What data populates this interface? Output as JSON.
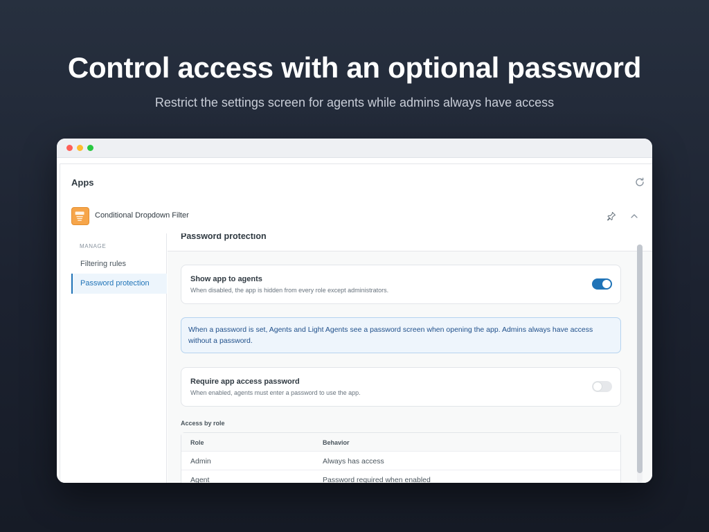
{
  "hero": {
    "title": "Control access with an optional password",
    "subtitle": "Restrict the settings screen for agents while admins always have access"
  },
  "window": {
    "controls": [
      "close",
      "minimize",
      "maximize"
    ]
  },
  "apps": {
    "header": "Apps",
    "refresh_icon": "refresh-icon",
    "app_name": "Conditional Dropdown Filter",
    "app_icon": "app-icon",
    "pin_icon": "pin-icon",
    "collapse_icon": "chevron-up-icon"
  },
  "sidebar": {
    "section": "MANAGE",
    "items": [
      {
        "label": "Filtering rules",
        "active": false
      },
      {
        "label": "Password protection",
        "active": true
      }
    ]
  },
  "content": {
    "title": "Password protection",
    "show_app": {
      "title": "Show app to agents",
      "description": "When disabled, the app is hidden from every role except administrators.",
      "enabled": true
    },
    "notice": "When a password is set, Agents and Light Agents see a password screen when opening the app. Admins always have access without a password.",
    "require_password": {
      "title": "Require app access password",
      "description": "When enabled, agents must enter a password to use the app.",
      "enabled": false
    },
    "access_by_role": {
      "label": "Access by role",
      "columns": [
        "Role",
        "Behavior"
      ],
      "rows": [
        [
          "Admin",
          "Always has access"
        ],
        [
          "Agent",
          "Password required when enabled"
        ]
      ]
    }
  },
  "colors": {
    "accent": "#1f73b7",
    "app_icon": "#f6a54a",
    "background": "#1c2230"
  }
}
